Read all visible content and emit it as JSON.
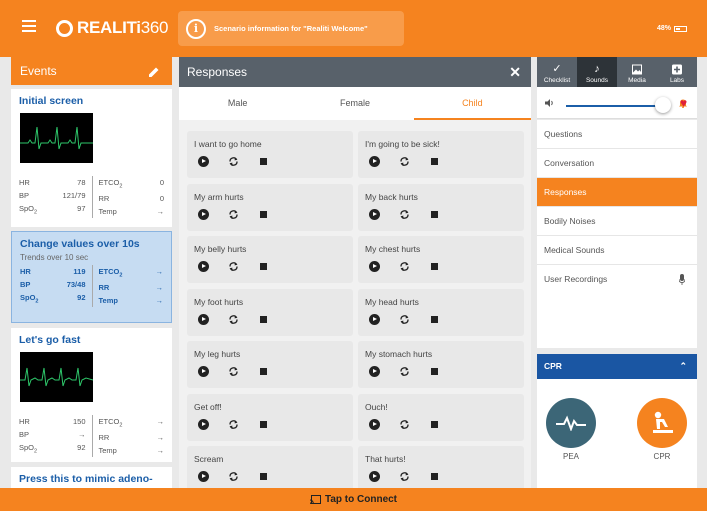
{
  "header": {
    "brand_main": "REALITi",
    "brand_num": "360",
    "info": "Scenario information for \"Realiti Welcome\"",
    "battery": "48%"
  },
  "events": {
    "title": "Events",
    "cards": [
      {
        "title": "Initial screen",
        "left": [
          [
            "HR",
            "78"
          ],
          [
            "BP",
            "121/79"
          ],
          [
            "SpO2",
            "97"
          ]
        ],
        "right": [
          [
            "ETCO2",
            "0"
          ],
          [
            "RR",
            "0"
          ],
          [
            "Temp",
            "→"
          ]
        ]
      },
      {
        "title": "Change values over 10s",
        "subtitle": "Trends over 10 sec",
        "left": [
          [
            "HR",
            "119"
          ],
          [
            "BP",
            "73/48"
          ],
          [
            "SpO2",
            "92"
          ]
        ],
        "right": [
          [
            "ETCO2",
            "→"
          ],
          [
            "RR",
            "→"
          ],
          [
            "Temp",
            "→"
          ]
        ]
      },
      {
        "title": "Let's go fast",
        "left": [
          [
            "HR",
            "150"
          ],
          [
            "BP",
            "→"
          ],
          [
            "SpO2",
            "92"
          ]
        ],
        "right": [
          [
            "ETCO2",
            "→"
          ],
          [
            "RR",
            "→"
          ],
          [
            "Temp",
            "→"
          ]
        ]
      },
      {
        "title": "Press this to mimic adeno-"
      }
    ]
  },
  "responses": {
    "title": "Responses",
    "tabs": [
      "Male",
      "Female",
      "Child"
    ],
    "active_tab": "Child",
    "items": [
      "I want to go home",
      "I'm going to be sick!",
      "My arm hurts",
      "My back hurts",
      "My belly hurts",
      "My chest hurts",
      "My foot hurts",
      "My head hurts",
      "My leg hurts",
      "My stomach hurts",
      "Get off!",
      "Ouch!",
      "Scream",
      "That hurts!"
    ]
  },
  "right_panel": {
    "tabs": [
      {
        "label": "Checklist",
        "icon": "checkmark-icon"
      },
      {
        "label": "Sounds",
        "icon": "music-note-icon"
      },
      {
        "label": "Media",
        "icon": "image-icon"
      },
      {
        "label": "Labs",
        "icon": "plus-box-icon"
      }
    ],
    "active_tab": "Sounds",
    "volume": 0.85,
    "menu": [
      "Questions",
      "Conversation",
      "Responses",
      "Bodily Noises",
      "Medical Sounds",
      "User Recordings"
    ],
    "active_menu": "Responses",
    "cpr": {
      "title": "CPR",
      "pea_label": "PEA",
      "cpr_label": "CPR"
    }
  },
  "footer": {
    "connect": "Tap to Connect"
  },
  "colors": {
    "accent": "#f5831f",
    "panel_header": "#58616a",
    "link_blue": "#1b5ea8",
    "cpr_blue": "#1a56a3",
    "pea_teal": "#3c6677"
  }
}
